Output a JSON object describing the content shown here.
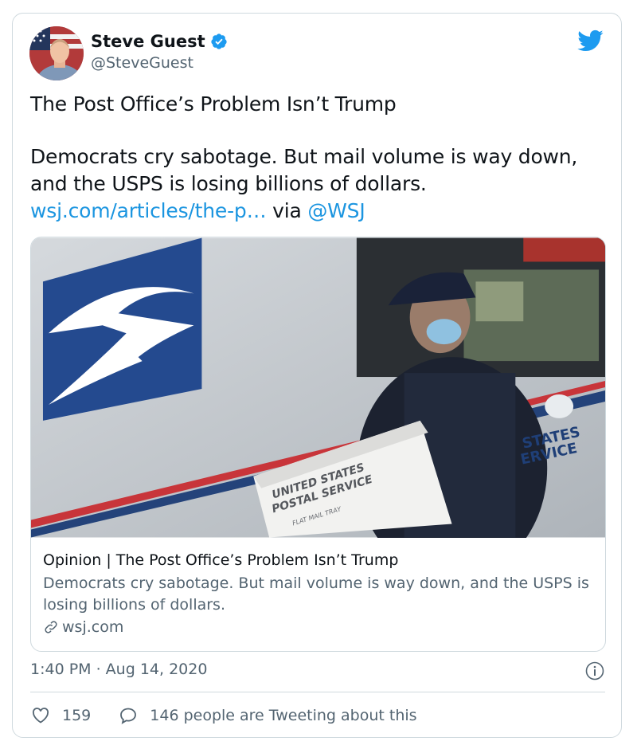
{
  "author": {
    "name": "Steve Guest",
    "handle": "@SteveGuest"
  },
  "tweet": {
    "headline": "The Post Office’s Problem Isn’t Trump",
    "body": "Democrats cry sabotage. But mail volume is way down, and the USPS is losing billions of dollars.",
    "link_text": "wsj.com/articles/the-p…",
    "via": "via",
    "mention": "@WSJ"
  },
  "card": {
    "title": "Opinion | The Post Office’s Problem Isn’t Trump",
    "description": "Democrats cry sabotage. But mail volume is way down, and the USPS is losing billions of dollars.",
    "domain": "wsj.com",
    "image_labels": {
      "box_line1": "UNITED STATES",
      "box_line2": "POSTAL SERVICE",
      "box_line3": "FLAT MAIL TRAY",
      "truck_line1": "STATES",
      "truck_line2": "ERVICE"
    }
  },
  "timestamp": "1:40 PM · Aug 14, 2020",
  "stats": {
    "likes": "159",
    "tweeting": "146 people are Tweeting about this"
  },
  "colors": {
    "link": "#1b95e0",
    "secondary_text": "#536471",
    "border": "#cfd9de"
  },
  "icons": [
    "verified-badge-icon",
    "twitter-bird-icon",
    "info-icon",
    "heart-icon",
    "reply-bubble-icon",
    "link-icon"
  ]
}
